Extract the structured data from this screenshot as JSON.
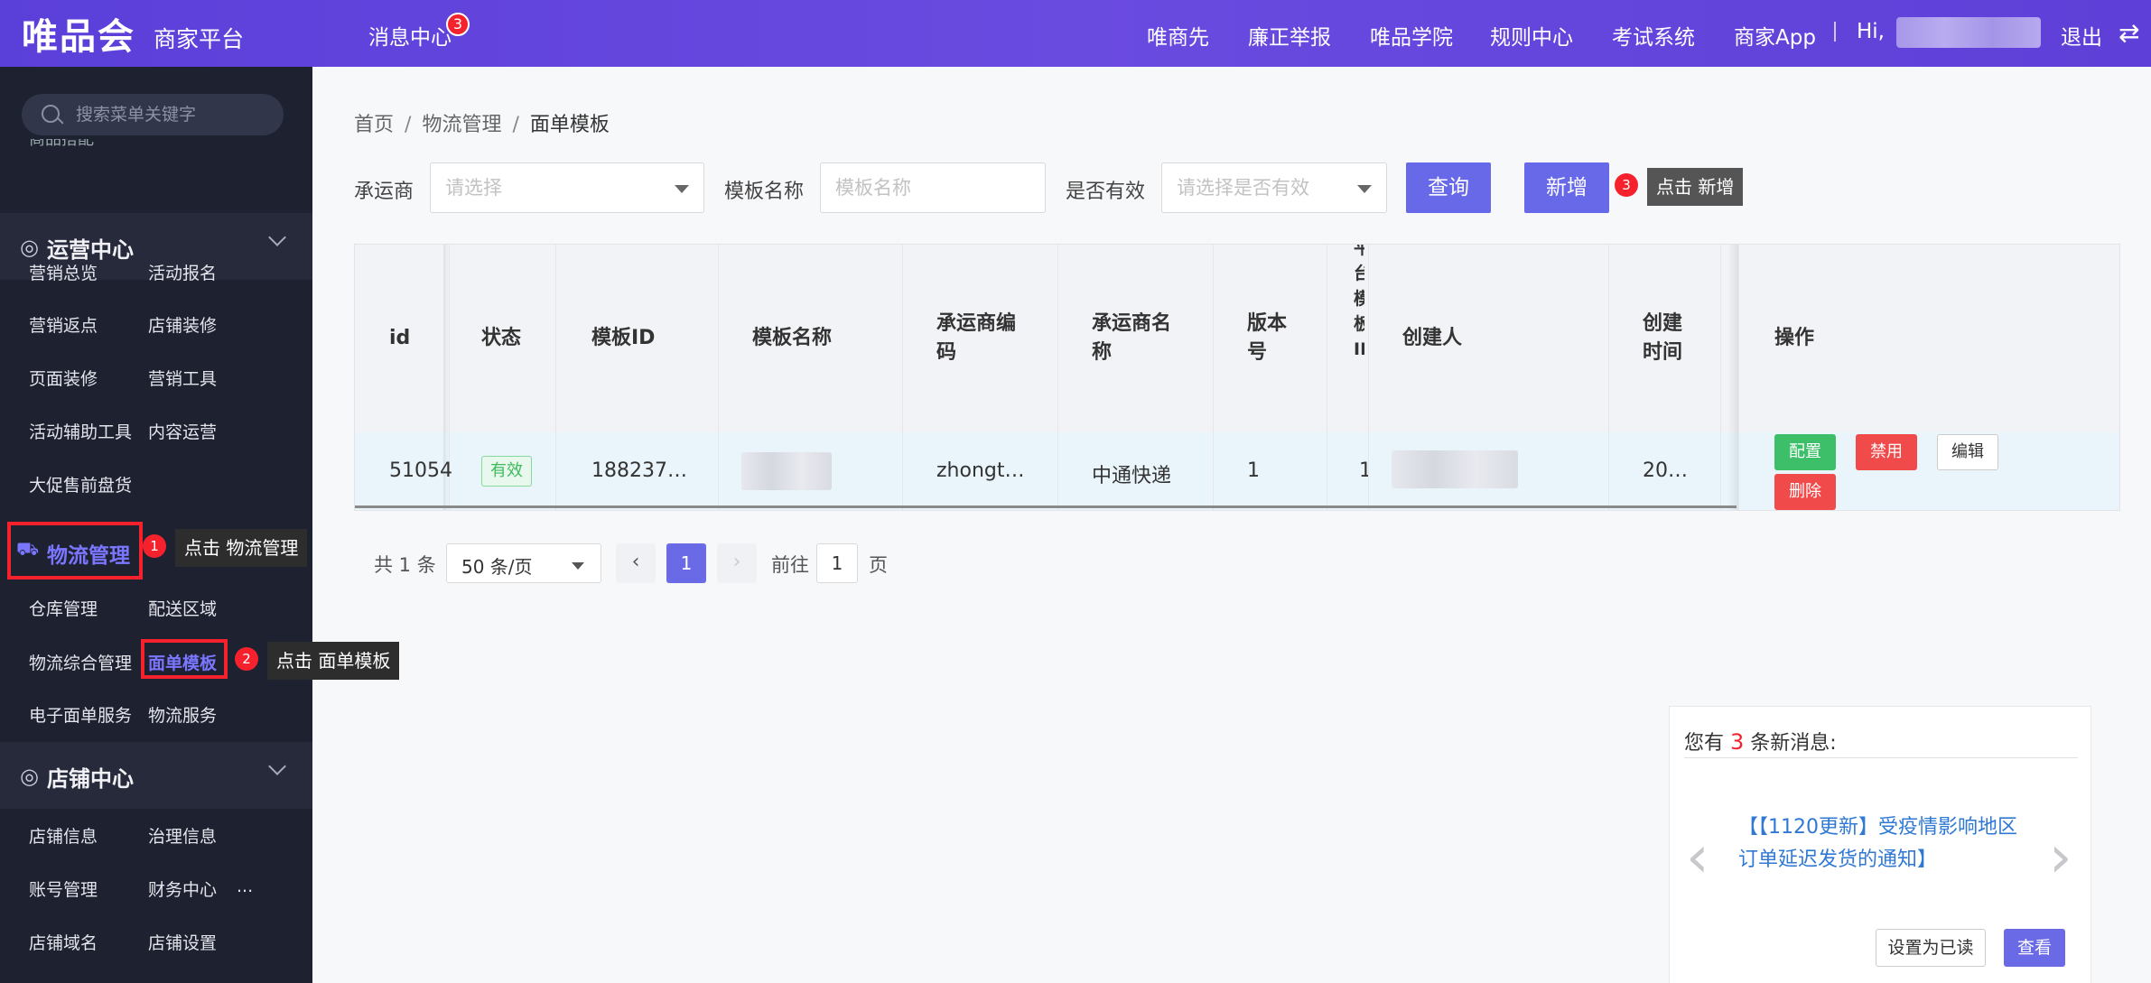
{
  "header": {
    "brand": "唯品会",
    "brand_sub": "商家平台",
    "msg_center": "消息中心",
    "msg_badge": "3",
    "nav": [
      "唯商先",
      "廉正举报",
      "唯品学院",
      "规则中心",
      "考试系统",
      "商家App"
    ],
    "hi": "Hi,",
    "logout": "退出",
    "swap_glyph": "⇄"
  },
  "sidebar": {
    "search_placeholder": "搜索菜单关键字",
    "cut_item": "商品搭配",
    "ops": {
      "title": "运营中心",
      "items": [
        "营销总览",
        "活动报名",
        "营销返点",
        "店铺装修",
        "页面装修",
        "营销工具",
        "活动辅助工具",
        "内容运营",
        "大促售前盘货"
      ]
    },
    "logistics": {
      "title": "物流管理",
      "items": [
        "仓库管理",
        "配送区域",
        "物流综合管理",
        "面单模板",
        "电子面单服务",
        "物流服务"
      ]
    },
    "store": {
      "title": "店铺中心",
      "items": [
        "店铺信息",
        "治理信息",
        "账号管理",
        "财务中心",
        "...",
        "店铺域名",
        "店铺设置"
      ]
    }
  },
  "guides": [
    {
      "num": "1",
      "text": "点击 物流管理"
    },
    {
      "num": "2",
      "text": "点击 面单模板"
    },
    {
      "num": "3",
      "text": "点击 新增"
    }
  ],
  "breadcrumb": [
    "首页",
    "物流管理",
    "面单模板"
  ],
  "filters": {
    "carrier_label": "承运商",
    "carrier_placeholder": "请选择",
    "name_label": "模板名称",
    "name_placeholder": "模板名称",
    "valid_label": "是否有效",
    "valid_placeholder": "请选择是否有效",
    "query_btn": "查询",
    "add_btn": "新增"
  },
  "table": {
    "headers": [
      "id",
      "状态",
      "模板ID",
      "模板名称",
      "承运商编码",
      "承运商名称",
      "版本号",
      "平台模板ID",
      "创建人",
      "创建时间",
      "操作"
    ],
    "row": {
      "id": "51054",
      "status": "有效",
      "template_id": "188237…",
      "carrier_code": "zhongt…",
      "carrier_name": "中通快递",
      "version": "1",
      "platform_id": "1",
      "created_at": "20…"
    },
    "ops": [
      "配置",
      "禁用",
      "编辑",
      "删除"
    ]
  },
  "pagination": {
    "total": "共 1 条",
    "page_size": "50 条/页",
    "current": "1",
    "goto_label": "前往",
    "goto_value": "1",
    "page_unit": "页",
    "prev_glyph": "‹",
    "next_glyph": "›"
  },
  "notice": {
    "prefix": "您有",
    "count": "3",
    "suffix": "条新消息:",
    "link": "【【1120更新】受疫情影响地区订单延迟发货的通知】",
    "left_arrow": "‹",
    "right_arrow": "›",
    "mark_read": "设置为已读",
    "view": "查看"
  },
  "colors": {
    "header": "#5b3fd9",
    "primary": "#6a6ae6",
    "danger": "#f5222d",
    "success": "#3dbf6a",
    "sidebar": "#1e2130"
  }
}
